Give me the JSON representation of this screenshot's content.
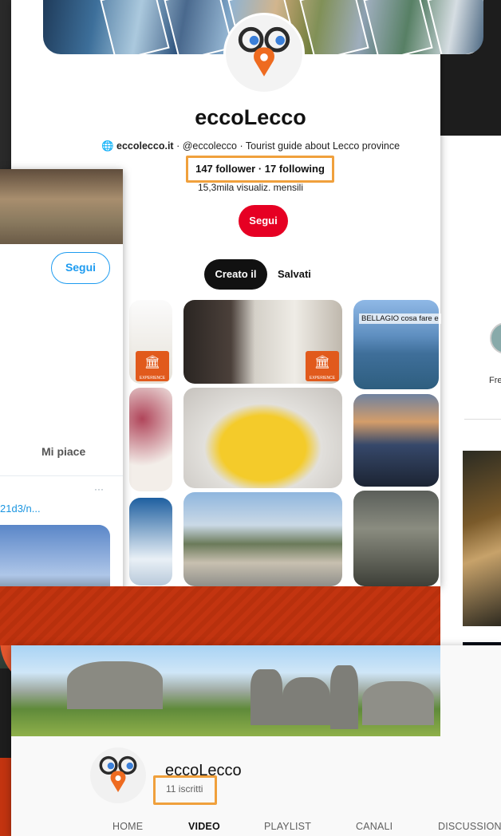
{
  "pinterest": {
    "title": "eccoLecco",
    "website": "eccolecco.it",
    "meta_rest": " · @eccolecco · Tourist guide about Lecco province",
    "followers": "147 follower · 17 following",
    "views": "15,3mila visualiz. mensili",
    "follow_button": "Segui",
    "tab_created": "Creato il",
    "tab_saved": "Salvati",
    "pin_label_bellagio": "BELLAGIO cosa fare e",
    "experience_label": "EXPERIENCE"
  },
  "twitter": {
    "follow_button": "Segui",
    "likes_tab": "Mi piace",
    "more": "···",
    "link_fragment": "21d3/n..."
  },
  "youtube": {
    "channel_name": "eccoLecco",
    "subscribers": "11 iscritti",
    "tabs": [
      "HOME",
      "VIDEO",
      "PLAYLIST",
      "CANALI",
      "DISCUSSIONE"
    ]
  },
  "right_fragment": {
    "label": "Fre"
  },
  "colors": {
    "pinterest_red": "#e60023",
    "twitter_blue": "#1d9bf0",
    "highlight_orange": "#f0a03c",
    "brand_orange": "#e4572e"
  }
}
